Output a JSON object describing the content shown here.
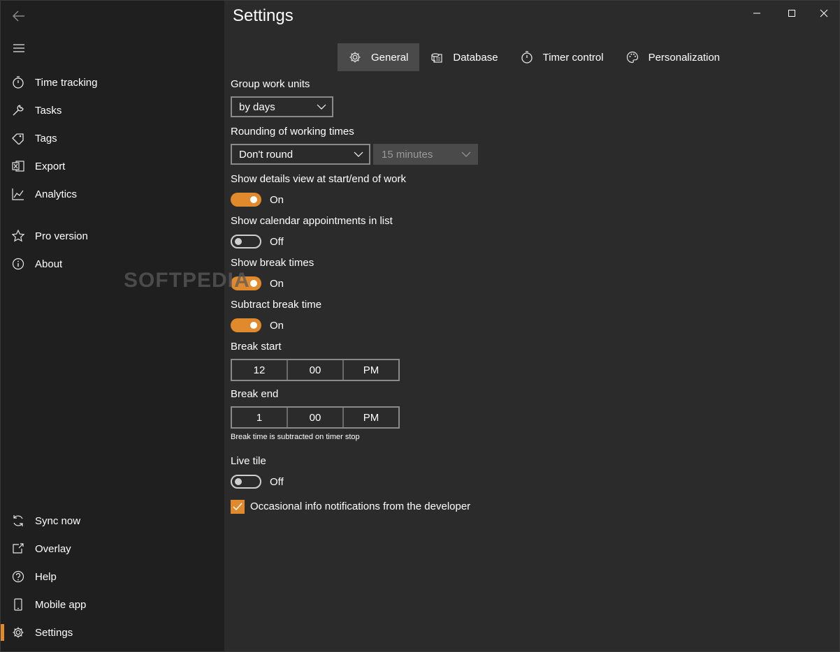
{
  "window": {
    "title": "Settings"
  },
  "sidebar": {
    "top_items": [
      {
        "label": "Time tracking",
        "icon": "stopwatch-icon"
      },
      {
        "label": "Tasks",
        "icon": "wrench-icon"
      },
      {
        "label": "Tags",
        "icon": "tag-icon"
      },
      {
        "label": "Export",
        "icon": "excel-icon"
      },
      {
        "label": "Analytics",
        "icon": "chart-icon"
      },
      {
        "label": "Pro version",
        "icon": "star-icon"
      },
      {
        "label": "About",
        "icon": "info-icon"
      }
    ],
    "bottom_items": [
      {
        "label": "Sync now",
        "icon": "sync-icon"
      },
      {
        "label": "Overlay",
        "icon": "overlay-icon"
      },
      {
        "label": "Help",
        "icon": "help-icon"
      },
      {
        "label": "Mobile app",
        "icon": "phone-icon"
      },
      {
        "label": "Settings",
        "icon": "gear-icon",
        "active": true
      }
    ]
  },
  "tabs": [
    {
      "label": "General",
      "icon": "gear-icon",
      "active": true
    },
    {
      "label": "Database",
      "icon": "database-icon"
    },
    {
      "label": "Timer control",
      "icon": "stopwatch-icon"
    },
    {
      "label": "Personalization",
      "icon": "palette-icon"
    }
  ],
  "settings": {
    "group_label": "Group work units",
    "group_value": "by days",
    "rounding_label": "Rounding of working times",
    "rounding_value": "Don't round",
    "rounding_interval": "15 minutes",
    "details_label": "Show details view at start/end of work",
    "details_state": "On",
    "calendar_label": "Show calendar appointments in list",
    "calendar_state": "Off",
    "break_times_label": "Show break times",
    "break_times_state": "On",
    "subtract_label": "Subtract break time",
    "subtract_state": "On",
    "break_start_label": "Break start",
    "break_start": {
      "hour": "12",
      "minute": "00",
      "period": "PM"
    },
    "break_end_label": "Break end",
    "break_end": {
      "hour": "1",
      "minute": "00",
      "period": "PM"
    },
    "break_note": "Break time is subtracted on timer stop",
    "live_tile_label": "Live tile",
    "live_tile_state": "Off",
    "notifications_label": "Occasional info notifications from the developer",
    "notifications_checked": true
  },
  "watermark": "SOFTPEDIA",
  "colors": {
    "accent": "#e0892d",
    "sidebar_bg": "#1f1f1f",
    "main_bg": "#2b2b2b"
  }
}
